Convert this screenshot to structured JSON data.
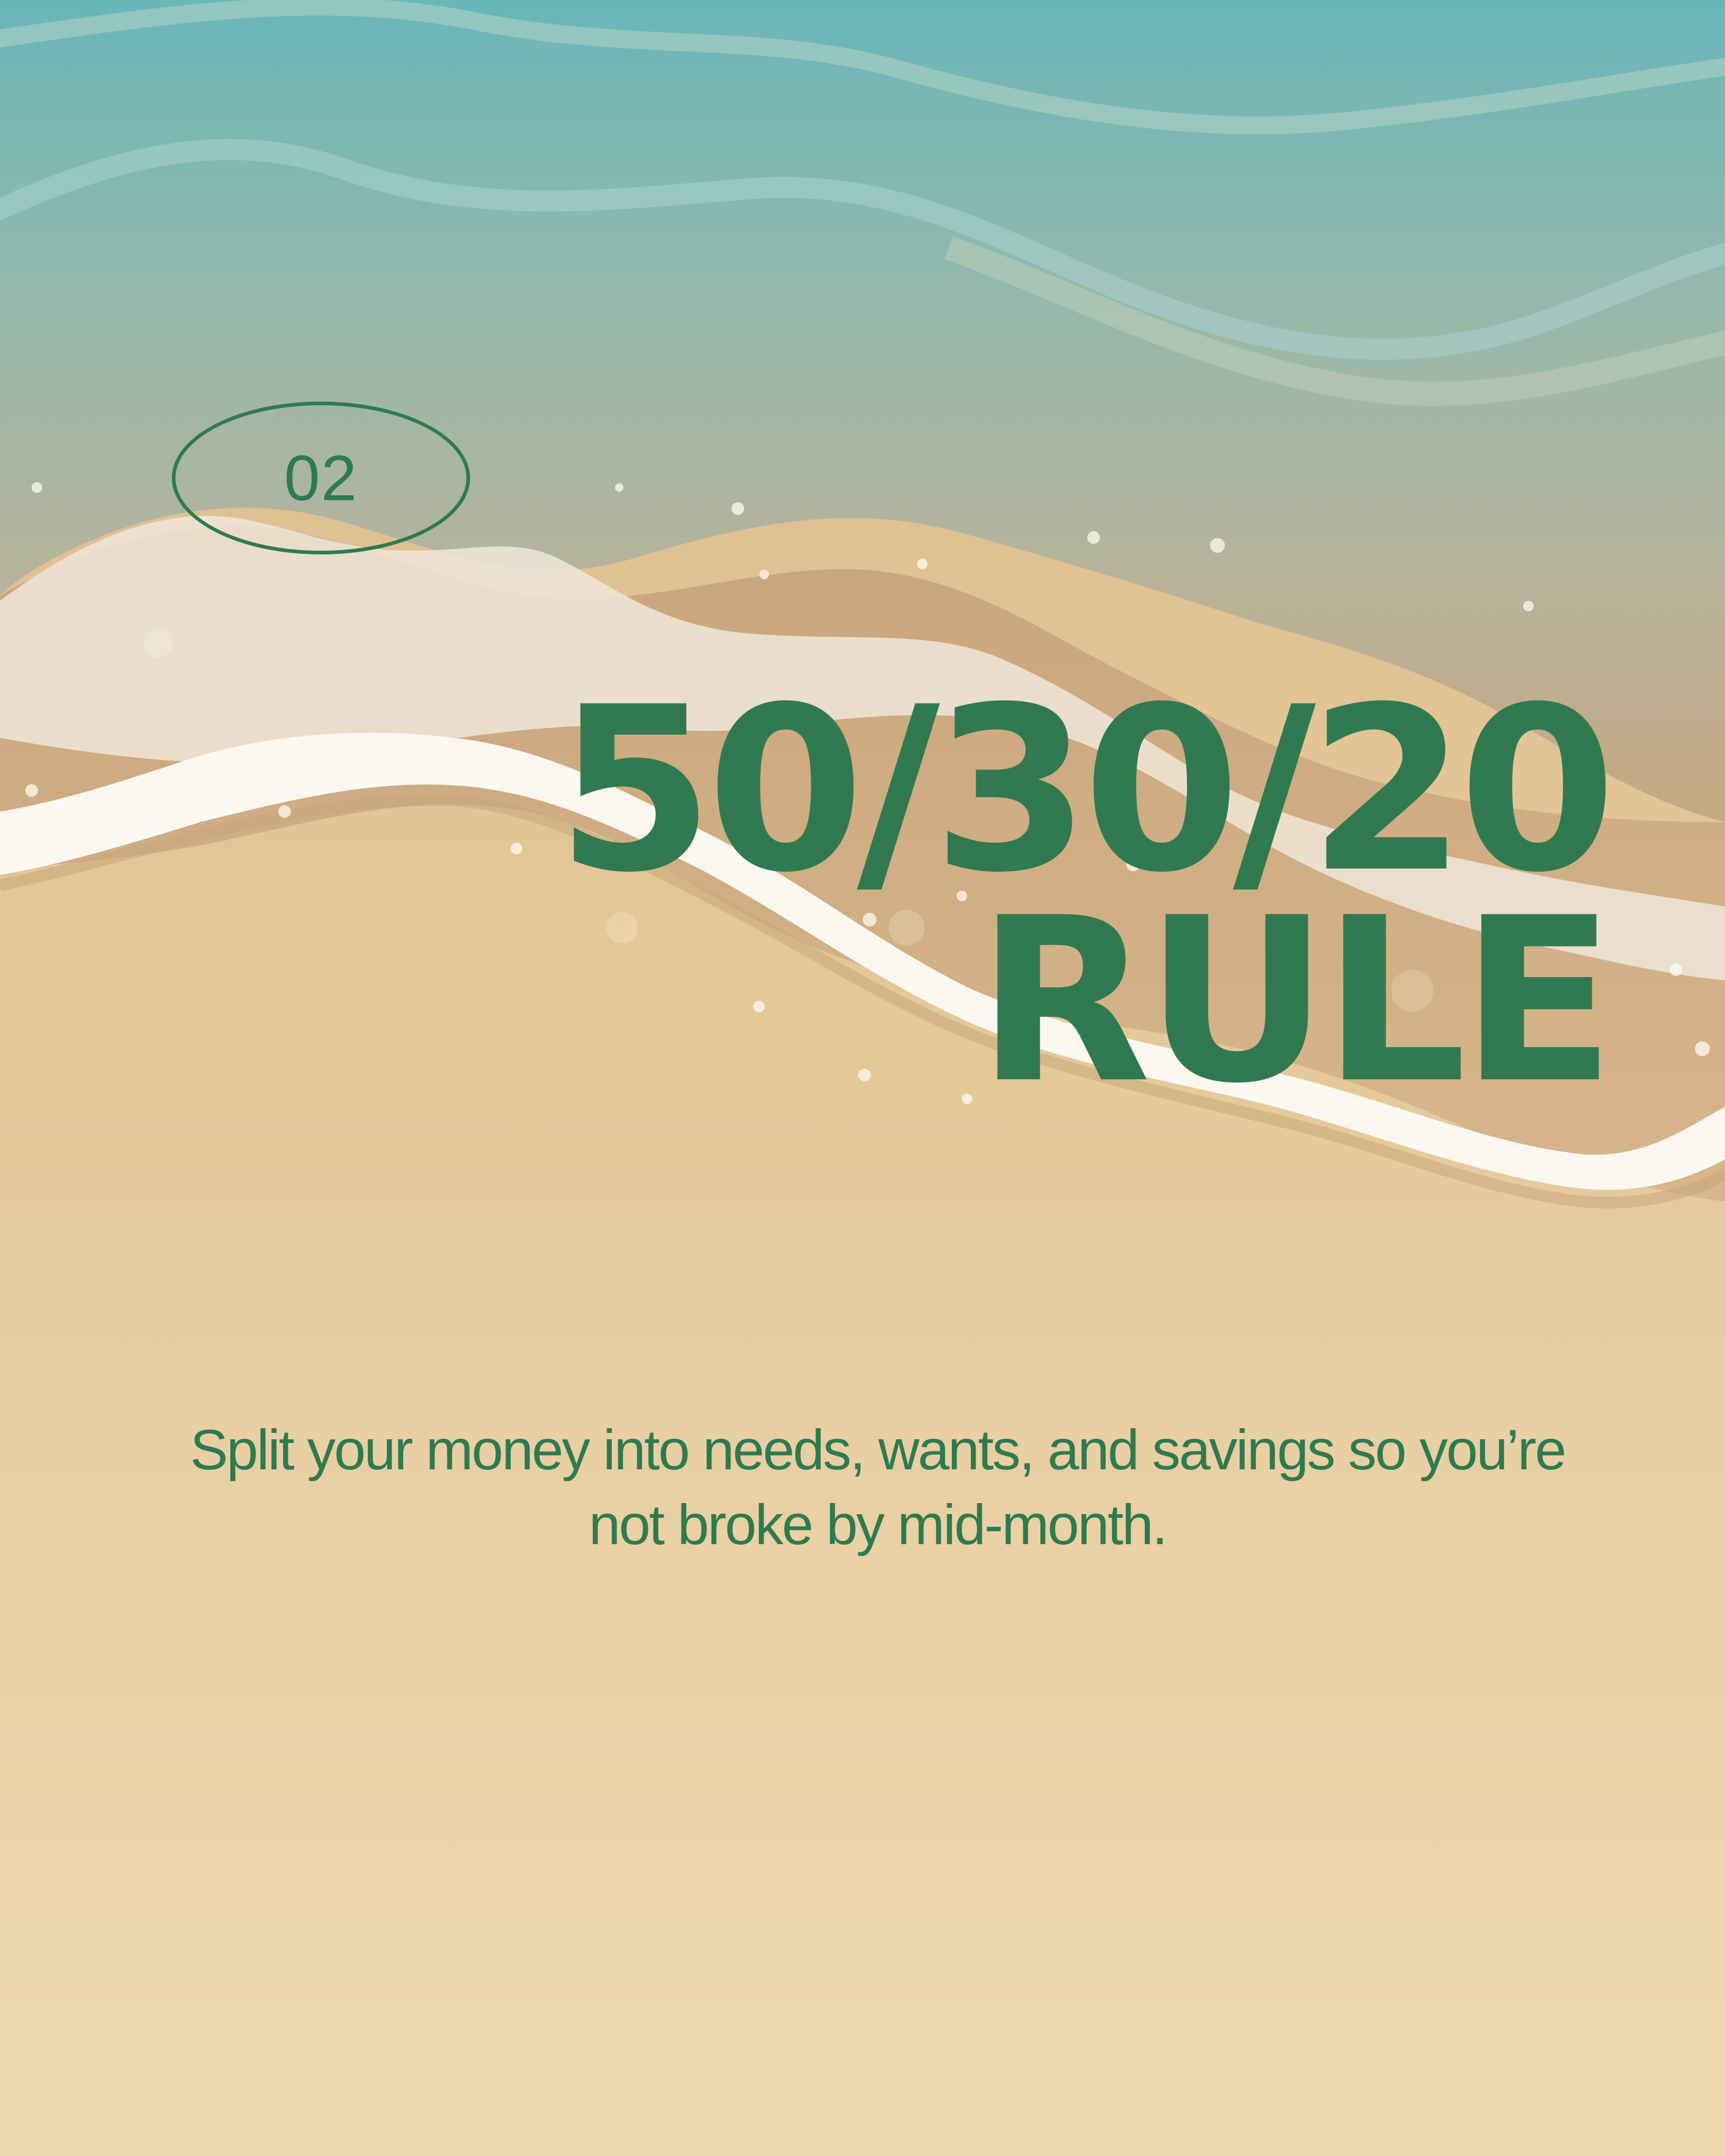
{
  "slide": {
    "number": "02",
    "title_line1": "50/30/20",
    "title_line2": "RULE",
    "description": "Split your money into needs, wants, and savings so you’re not broke by mid-month."
  },
  "colors": {
    "accent_green": "#2f7a4f",
    "sea_top": "#6fb8b7",
    "foam": "#f4efe6",
    "sand": "#ecd6af"
  }
}
